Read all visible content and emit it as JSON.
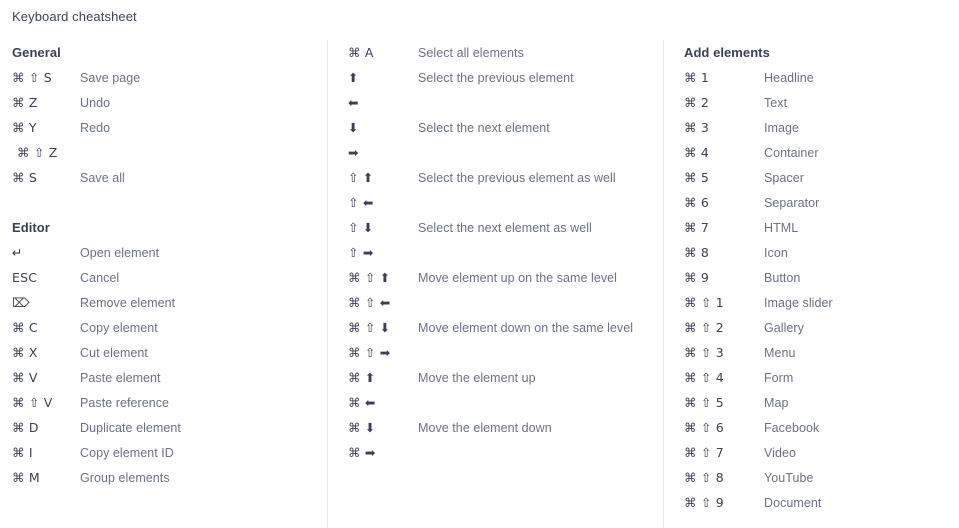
{
  "page": {
    "title": "Keyboard cheatsheet",
    "background_color": "#ffffff",
    "heading_color": "#3b4154",
    "key_color": "#3b4154",
    "label_color": "#6b7285",
    "divider_color": "#e6e8ee"
  },
  "columns": [
    {
      "id": "left",
      "sections": [
        {
          "id": "general",
          "heading": "General",
          "rows": [
            {
              "keys": "⌘ ⇧ S",
              "label": "Save page",
              "indented": false
            },
            {
              "keys": "⌘ Z",
              "label": "Undo",
              "indented": false
            },
            {
              "keys": "⌘ Y",
              "label": "Redo",
              "indented": false
            },
            {
              "keys": "⌘ ⇧ Z",
              "label": "",
              "indented": true
            },
            {
              "keys": "⌘ S",
              "label": "Save all",
              "indented": false
            }
          ]
        },
        {
          "id": "editor",
          "heading": "Editor",
          "rows": [
            {
              "keys": "↵",
              "label": "Open element",
              "indented": false
            },
            {
              "keys": "ESC",
              "label": "Cancel",
              "indented": false
            },
            {
              "keys": "⌦",
              "label": "Remove element",
              "indented": false
            },
            {
              "keys": "⌘ C",
              "label": "Copy element",
              "indented": false
            },
            {
              "keys": "⌘ X",
              "label": "Cut element",
              "indented": false
            },
            {
              "keys": "⌘ V",
              "label": "Paste element",
              "indented": false
            },
            {
              "keys": "⌘ ⇧ V",
              "label": "Paste reference",
              "indented": false
            },
            {
              "keys": "⌘ D",
              "label": "Duplicate element",
              "indented": false
            },
            {
              "keys": "⌘ I",
              "label": "Copy element ID",
              "indented": false
            },
            {
              "keys": "⌘ M",
              "label": "Group elements",
              "indented": false
            }
          ]
        }
      ]
    },
    {
      "id": "middle",
      "sections": [
        {
          "id": "selection",
          "heading": "",
          "rows": [
            {
              "keys": "⌘ A",
              "label": "Select all elements",
              "indented": false
            },
            {
              "keys": "⬆",
              "label": "Select the previous element",
              "indented": false
            },
            {
              "keys": "⬅",
              "label": "",
              "indented": false
            },
            {
              "keys": "⬇",
              "label": "Select the next element",
              "indented": false
            },
            {
              "keys": "➡",
              "label": "",
              "indented": false
            },
            {
              "keys": "⇧ ⬆",
              "label": "Select the previous element as well",
              "indented": false
            },
            {
              "keys": "⇧ ⬅",
              "label": "",
              "indented": false
            },
            {
              "keys": "⇧ ⬇",
              "label": "Select the next element as well",
              "indented": false
            },
            {
              "keys": "⇧ ➡",
              "label": "",
              "indented": false
            },
            {
              "keys": "⌘ ⇧ ⬆",
              "label": "Move element up on the same level",
              "indented": false
            },
            {
              "keys": "⌘ ⇧ ⬅",
              "label": "",
              "indented": false
            },
            {
              "keys": "⌘ ⇧ ⬇",
              "label": "Move element down on the same level",
              "indented": false
            },
            {
              "keys": "⌘ ⇧ ➡",
              "label": "",
              "indented": false
            },
            {
              "keys": "⌘ ⬆",
              "label": "Move the element up",
              "indented": false
            },
            {
              "keys": "⌘ ⬅",
              "label": "",
              "indented": false
            },
            {
              "keys": "⌘ ⬇",
              "label": "Move the element down",
              "indented": false
            },
            {
              "keys": "⌘ ➡",
              "label": "",
              "indented": false
            }
          ]
        }
      ]
    },
    {
      "id": "right",
      "sections": [
        {
          "id": "add-elements",
          "heading": "Add elements",
          "rows": [
            {
              "keys": "⌘ 1",
              "label": "Headline",
              "indented": false
            },
            {
              "keys": "⌘ 2",
              "label": "Text",
              "indented": false
            },
            {
              "keys": "⌘ 3",
              "label": "Image",
              "indented": false
            },
            {
              "keys": "⌘ 4",
              "label": "Container",
              "indented": false
            },
            {
              "keys": "⌘ 5",
              "label": "Spacer",
              "indented": false
            },
            {
              "keys": "⌘ 6",
              "label": "Separator",
              "indented": false
            },
            {
              "keys": "⌘ 7",
              "label": "HTML",
              "indented": false
            },
            {
              "keys": "⌘ 8",
              "label": "Icon",
              "indented": false
            },
            {
              "keys": "⌘ 9",
              "label": "Button",
              "indented": false
            },
            {
              "keys": "⌘ ⇧ 1",
              "label": "Image slider",
              "indented": false
            },
            {
              "keys": "⌘ ⇧ 2",
              "label": "Gallery",
              "indented": false
            },
            {
              "keys": "⌘ ⇧ 3",
              "label": "Menu",
              "indented": false
            },
            {
              "keys": "⌘ ⇧ 4",
              "label": "Form",
              "indented": false
            },
            {
              "keys": "⌘ ⇧ 5",
              "label": "Map",
              "indented": false
            },
            {
              "keys": "⌘ ⇧ 6",
              "label": "Facebook",
              "indented": false
            },
            {
              "keys": "⌘ ⇧ 7",
              "label": "Video",
              "indented": false
            },
            {
              "keys": "⌘ ⇧ 8",
              "label": "YouTube",
              "indented": false
            },
            {
              "keys": "⌘ ⇧ 9",
              "label": "Document",
              "indented": false
            }
          ]
        }
      ]
    }
  ]
}
